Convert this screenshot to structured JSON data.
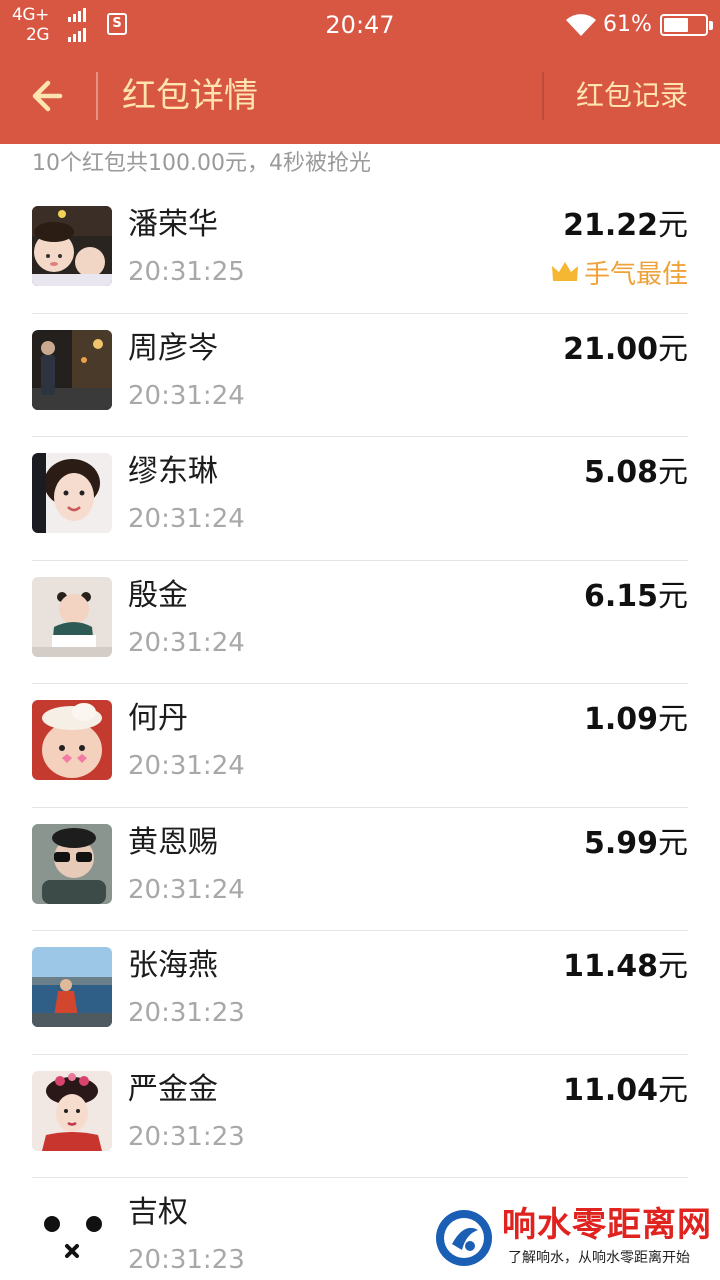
{
  "status_bar": {
    "net_top": "4G+",
    "net_bottom": "2G",
    "sim_icon": "S",
    "time": "20:47",
    "battery_pct": "61%",
    "battery_level": 0.61,
    "color": "#d85742"
  },
  "nav": {
    "back_icon": "arrow-left-icon",
    "title": "红包详情",
    "record_label": "红包记录",
    "title_color": "#ffe3b0"
  },
  "summary": "10个红包共100.00元，4秒被抢光",
  "recipients": [
    {
      "name": "潘荣华",
      "time": "20:31:25",
      "amount": "21.22",
      "unit": "元",
      "best_label": "手气最佳"
    },
    {
      "name": "周彦岑",
      "time": "20:31:24",
      "amount": "21.00",
      "unit": "元"
    },
    {
      "name": "缪东琳",
      "time": "20:31:24",
      "amount": "5.08",
      "unit": "元"
    },
    {
      "name": "殷金",
      "time": "20:31:24",
      "amount": "6.15",
      "unit": "元"
    },
    {
      "name": "何丹",
      "time": "20:31:24",
      "amount": "1.09",
      "unit": "元"
    },
    {
      "name": "黄恩赐",
      "time": "20:31:24",
      "amount": "5.99",
      "unit": "元"
    },
    {
      "name": "张海燕",
      "time": "20:31:23",
      "amount": "11.48",
      "unit": "元"
    },
    {
      "name": "严金金",
      "time": "20:31:23",
      "amount": "11.04",
      "unit": "元"
    },
    {
      "name": "吉权",
      "time": "20:31:23",
      "amount": "",
      "unit": ""
    }
  ],
  "watermark": {
    "title": "响水零距离网",
    "subtitle": "了解响水，从响水零距离开始"
  }
}
